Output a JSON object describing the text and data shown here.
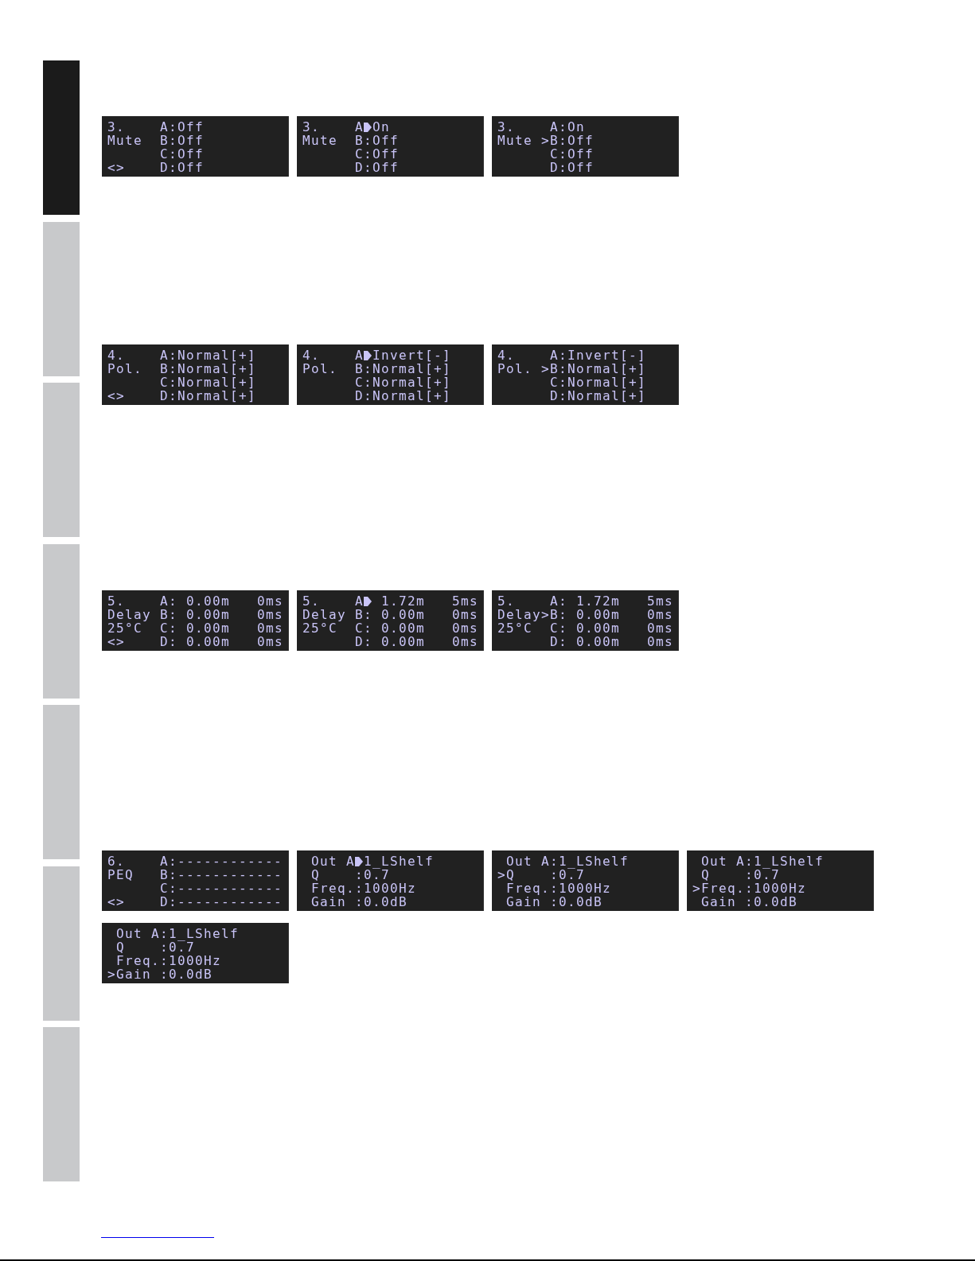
{
  "chapter_tabs": [
    {
      "selected": true
    },
    {
      "selected": false
    },
    {
      "selected": false
    },
    {
      "selected": false
    },
    {
      "selected": false
    },
    {
      "selected": false
    },
    {
      "selected": false
    }
  ],
  "sections": [
    {
      "displays": [
        {
          "kind": "channels",
          "rows": [
            {
              "label": "3.",
              "key": "A:",
              "editing": false,
              "value": "Off"
            },
            {
              "label": "Mute",
              "key": "B:",
              "editing": false,
              "value": "Off"
            },
            {
              "key": "C:",
              "editing": false,
              "value": "Off"
            },
            {
              "label": "<>",
              "key": "D:",
              "editing": false,
              "value": "Off"
            }
          ]
        },
        {
          "kind": "channels",
          "rows": [
            {
              "label": "3.",
              "key": "A",
              "editing": true,
              "value": "On"
            },
            {
              "label": "Mute",
              "key": "B:",
              "editing": false,
              "value": "Off"
            },
            {
              "key": "C:",
              "editing": false,
              "value": "Off"
            },
            {
              "key": "D:",
              "editing": false,
              "value": "Off"
            }
          ]
        },
        {
          "kind": "channels",
          "rows": [
            {
              "label": "3.",
              "key": "A:",
              "editing": false,
              "value": "On"
            },
            {
              "label": "Mute",
              "marker": ">",
              "key": "B:",
              "editing": false,
              "value": "Off"
            },
            {
              "key": "C:",
              "editing": false,
              "value": "Off"
            },
            {
              "key": "D:",
              "editing": false,
              "value": "Off"
            }
          ]
        }
      ]
    },
    {
      "displays": [
        {
          "kind": "channels",
          "rows": [
            {
              "label": "4.",
              "key": "A:",
              "editing": false,
              "value": "Normal[+]"
            },
            {
              "label": "Pol.",
              "key": "B:",
              "editing": false,
              "value": "Normal[+]"
            },
            {
              "key": "C:",
              "editing": false,
              "value": "Normal[+]"
            },
            {
              "label": "<>",
              "key": "D:",
              "editing": false,
              "value": "Normal[+]"
            }
          ]
        },
        {
          "kind": "channels",
          "rows": [
            {
              "label": "4.",
              "key": "A",
              "editing": true,
              "value": "Invert[-]"
            },
            {
              "label": "Pol.",
              "key": "B:",
              "editing": false,
              "value": "Normal[+]"
            },
            {
              "key": "C:",
              "editing": false,
              "value": "Normal[+]"
            },
            {
              "key": "D:",
              "editing": false,
              "value": "Normal[+]"
            }
          ]
        },
        {
          "kind": "channels",
          "rows": [
            {
              "label": "4.",
              "key": "A:",
              "editing": false,
              "value": "Invert[-]"
            },
            {
              "label": "Pol.",
              "marker": ">",
              "key": "B:",
              "editing": false,
              "value": "Normal[+]"
            },
            {
              "key": "C:",
              "editing": false,
              "value": "Normal[+]"
            },
            {
              "key": "D:",
              "editing": false,
              "value": "Normal[+]"
            }
          ]
        }
      ]
    },
    {
      "displays": [
        {
          "kind": "delay",
          "rows": [
            {
              "label": "5.",
              "key": "A:",
              "editing": false,
              "value": "0.00m",
              "time": "0ms"
            },
            {
              "label": "Delay",
              "key": "B:",
              "editing": false,
              "value": "0.00m",
              "time": "0ms"
            },
            {
              "label": "25°C",
              "key": "C:",
              "editing": false,
              "value": "0.00m",
              "time": "0ms"
            },
            {
              "label": "<>",
              "key": "D:",
              "editing": false,
              "value": "0.00m",
              "time": "0ms"
            }
          ]
        },
        {
          "kind": "delay",
          "rows": [
            {
              "label": "5.",
              "key": "A",
              "editing": true,
              "value": "1.72m",
              "time": "5ms"
            },
            {
              "label": "Delay",
              "key": "B:",
              "editing": false,
              "value": "0.00m",
              "time": "0ms"
            },
            {
              "label": "25°C",
              "key": "C:",
              "editing": false,
              "value": "0.00m",
              "time": "0ms"
            },
            {
              "key": "D:",
              "editing": false,
              "value": "0.00m",
              "time": "0ms"
            }
          ]
        },
        {
          "kind": "delay",
          "rows": [
            {
              "label": "5.",
              "key": "A:",
              "editing": false,
              "value": "1.72m",
              "time": "5ms"
            },
            {
              "label": "Delay",
              "marker": ">",
              "key": "B:",
              "editing": false,
              "value": "0.00m",
              "time": "0ms"
            },
            {
              "label": "25°C",
              "key": "C:",
              "editing": false,
              "value": "0.00m",
              "time": "0ms"
            },
            {
              "key": "D:",
              "editing": false,
              "value": "0.00m",
              "time": "0ms"
            }
          ]
        }
      ]
    },
    {
      "displays": [
        {
          "kind": "channels",
          "rows": [
            {
              "label": "6.",
              "key": "A:",
              "editing": false,
              "value": "------------"
            },
            {
              "label": "PEQ",
              "key": "B:",
              "editing": false,
              "value": "------------"
            },
            {
              "key": "C:",
              "editing": false,
              "value": "------------"
            },
            {
              "label": "<>",
              "key": "D:",
              "editing": false,
              "value": "------------"
            }
          ]
        },
        {
          "kind": "parameters",
          "rows": [
            {
              "key": "Out A",
              "editing": true,
              "value": "1_LShelf"
            },
            {
              "key": "Q    :",
              "editing": false,
              "value": "0.7"
            },
            {
              "key": "Freq.:",
              "editing": false,
              "value": "1000Hz"
            },
            {
              "key": "Gain :",
              "editing": false,
              "value": "0.0dB"
            }
          ]
        },
        {
          "kind": "parameters",
          "rows": [
            {
              "key": "Out A:",
              "editing": false,
              "value": "1_LShelf"
            },
            {
              "marker": ">",
              "key": "Q    :",
              "editing": false,
              "value": "0.7"
            },
            {
              "key": "Freq.:",
              "editing": false,
              "value": "1000Hz"
            },
            {
              "key": "Gain :",
              "editing": false,
              "value": "0.0dB"
            }
          ]
        },
        {
          "kind": "parameters",
          "rows": [
            {
              "key": "Out A:",
              "editing": false,
              "value": "1_LShelf"
            },
            {
              "key": "Q    :",
              "editing": false,
              "value": "0.7"
            },
            {
              "marker": ">",
              "key": "Freq.:",
              "editing": false,
              "value": "1000Hz"
            },
            {
              "key": "Gain :",
              "editing": false,
              "value": "0.0dB"
            }
          ]
        },
        {
          "kind": "parameters",
          "rows": [
            {
              "key": "Out A:",
              "editing": false,
              "value": "1_LShelf"
            },
            {
              "key": "Q    :",
              "editing": false,
              "value": "0.7"
            },
            {
              "key": "Freq.:",
              "editing": false,
              "value": "1000Hz"
            },
            {
              "marker": ">",
              "key": "Gain :",
              "editing": false,
              "value": "0.0dB"
            }
          ]
        }
      ]
    }
  ]
}
